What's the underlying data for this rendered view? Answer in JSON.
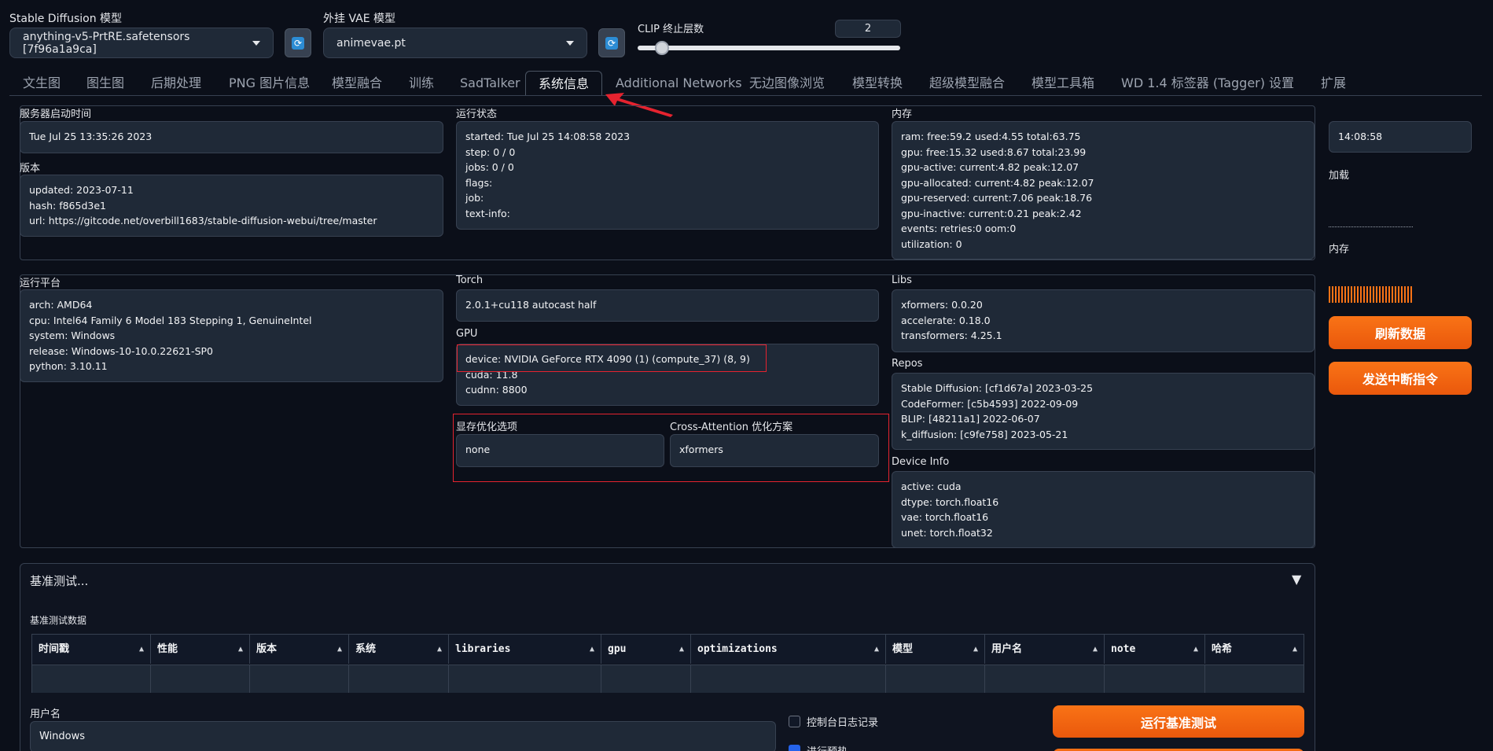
{
  "top": {
    "sd_model_label": "Stable Diffusion 模型",
    "sd_model_value": "anything-v5-PrtRE.safetensors [7f96a1a9ca]",
    "vae_label": "外挂 VAE 模型",
    "vae_value": "animevae.pt",
    "clip_label": "CLIP 终止层数",
    "clip_value": "2"
  },
  "tabs": [
    "文生图",
    "图生图",
    "后期处理",
    "PNG 图片信息",
    "模型融合",
    "训练",
    "SadTalker",
    "系统信息",
    "Additional Networks",
    "无边图像浏览",
    "模型转换",
    "超级模型融合",
    "模型工具箱",
    "WD 1.4 标签器 (Tagger)",
    "设置",
    "扩展"
  ],
  "sysinfo": {
    "server_start": {
      "label": "服务器启动时间",
      "value": "Tue Jul 25 13:35:26 2023"
    },
    "version": {
      "label": "版本",
      "lines": [
        "updated: 2023-07-11",
        "hash: f865d3e1",
        "url: https://gitcode.net/overbill1683/stable-diffusion-webui/tree/master"
      ]
    },
    "run_state": {
      "label": "运行状态",
      "lines": [
        "started: Tue Jul 25 14:08:58 2023",
        "step: 0 / 0",
        "jobs: 0 / 0",
        "flags:",
        "job:",
        "text-info:"
      ]
    },
    "memory": {
      "label": "内存",
      "lines": [
        "ram: free:59.2 used:4.55 total:63.75",
        "gpu: free:15.32 used:8.67 total:23.99",
        "gpu-active: current:4.82 peak:12.07",
        "gpu-allocated: current:4.82 peak:12.07",
        "gpu-reserved: current:7.06 peak:18.76",
        "gpu-inactive: current:0.21 peak:2.42",
        "events: retries:0 oom:0",
        "utilization: 0"
      ]
    },
    "platform": {
      "label": "运行平台",
      "lines": [
        "arch: AMD64",
        "cpu: Intel64 Family 6 Model 183 Stepping 1, GenuineIntel",
        "system: Windows",
        "release: Windows-10-10.0.22621-SP0",
        "python: 3.10.11"
      ]
    },
    "torch": {
      "label": "Torch",
      "value": "2.0.1+cu118 autocast  half"
    },
    "gpu": {
      "label": "GPU",
      "lines": [
        "device: NVIDIA GeForce RTX 4090 (1) (compute_37) (8, 9)",
        "cuda: 11.8",
        "cudnn: 8800"
      ]
    },
    "vram_opt": {
      "label": "显存优化选项",
      "value": "none"
    },
    "cross_attn": {
      "label": "Cross-Attention 优化方案",
      "value": "xformers"
    },
    "libs": {
      "label": "Libs",
      "lines": [
        "xformers: 0.0.20",
        "accelerate: 0.18.0",
        "transformers: 4.25.1"
      ]
    },
    "repos": {
      "label": "Repos",
      "lines": [
        "Stable Diffusion: [cf1d67a] 2023-03-25",
        "CodeFormer: [c5b4593] 2022-09-09",
        "BLIP: [48211a1] 2022-06-07",
        "k_diffusion: [c9fe758] 2023-05-21"
      ]
    },
    "device_info": {
      "label": "Device Info",
      "lines": [
        "active: cuda",
        "dtype: torch.float16",
        "vae: torch.float16",
        "unet: torch.float32"
      ]
    }
  },
  "side": {
    "time_value": "14:08:58",
    "load_label": "加载",
    "memory_label": "内存",
    "refresh_button": "刷新数据",
    "interrupt_button": "发送中断指令"
  },
  "benchmark": {
    "title": "基准测试...",
    "toggle": "▼",
    "data_label": "基准测试数据",
    "columns": [
      "时间戳",
      "性能",
      "版本",
      "系统",
      "libraries",
      "gpu",
      "optimizations",
      "模型",
      "用户名",
      "note",
      "哈希"
    ],
    "sort_glyph": "▲",
    "username_label": "用户名",
    "username_value": "Windows",
    "console_log_label": "控制台日志记录",
    "warmup_label": "进行预热",
    "run_button": "运行基准测试"
  }
}
